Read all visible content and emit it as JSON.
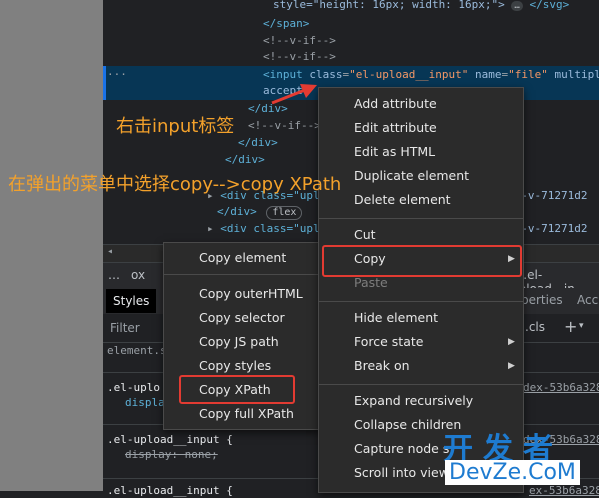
{
  "code": {
    "line1": "style=\"height: 16px; width: 16px;\">",
    "line1_ellipsis": "…",
    "line1_end": "</svg>",
    "line2": "</span>",
    "line3": "<!--v-if-->",
    "line4": "<!--v-if-->",
    "hl_tag_open": "<input",
    "hl_attr1": "class",
    "hl_val1": "\"el-upload__input\"",
    "hl_attr2": "name",
    "hl_val2": "\"file\"",
    "hl_attr3": "multipl",
    "hl_line2": "accept",
    "hl_dots": "…",
    "line6": "</div>",
    "line7": "<!--v-if-->",
    "line8": "</div>",
    "line9": "</div>",
    "line10_tag": "<div class=\"uplo",
    "line10_tail": "ta-v-71271d2",
    "line11": "</div>",
    "line11_badge": "flex",
    "line12_tag": "<div class=\"uplo",
    "line12_tail": "ta-v-71271d2"
  },
  "crumbs": {
    "prefix": "… ",
    "crumb_left": "ox",
    "crumb_right": "ut.el-upload__in"
  },
  "tabs": {
    "styles": "Styles",
    "properties": "perties",
    "acc": "Acc"
  },
  "filterbar": {
    "placeholder": "Filter",
    "cls": ".cls",
    "plus": "+"
  },
  "styles": {
    "element_style": "element.s",
    "rule1_sel": ".el-uplo",
    "rule1_prop": "displa",
    "rule1_src": "dex-53b6a328",
    "rule2_sel": ".el-upload__input {",
    "rule2_prop": "display: none;",
    "rule2_src": "dex-53b6a328",
    "rule3_sel": ".el-upload__input {",
    "rule3_src": "ex-53b6a328"
  },
  "menu_main": {
    "items": [
      "Add attribute",
      "Edit attribute",
      "Edit as HTML",
      "Duplicate element",
      "Delete element",
      "Cut",
      "Copy",
      "Paste",
      "Hide element",
      "Force state",
      "Break on",
      "Expand recursively",
      "Collapse children",
      "Capture node s",
      "Scroll into view"
    ]
  },
  "menu_copy": {
    "items": [
      "Copy element",
      "Copy outerHTML",
      "Copy selector",
      "Copy JS path",
      "Copy styles",
      "Copy XPath",
      "Copy full XPath"
    ]
  },
  "annotations": {
    "right_click": "右击input标签",
    "choose": "在弹出的菜单中选择copy-->copy XPath"
  },
  "watermark": {
    "cn": "开发者",
    "en": "DevZe.CoM"
  },
  "colors": {
    "highlight_box": "#e23b32",
    "annotation": "#f3a12b",
    "selection_row": "#073655"
  }
}
